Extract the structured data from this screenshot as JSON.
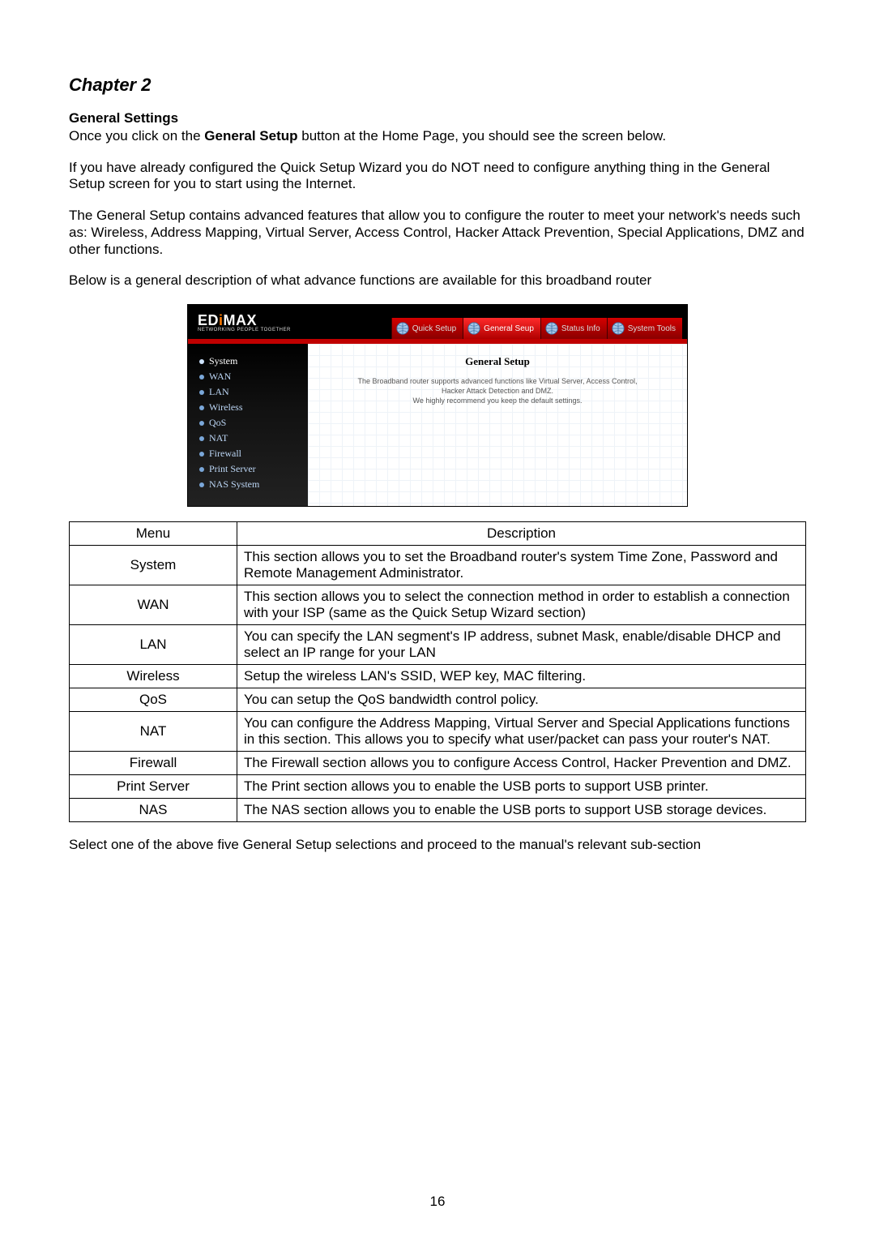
{
  "chapter_title": "Chapter 2",
  "section_title": "General Settings",
  "para1_a": "Once you click on the ",
  "para1_bold": "General Setup",
  "para1_b": " button at the Home Page, you should see the screen below.",
  "para2": "If you have already configured the Quick Setup Wizard you do NOT need to configure anything thing in the General Setup screen for you to start using the Internet.",
  "para3": "The General Setup contains advanced features that allow you to configure the router to meet your network's needs such as: Wireless, Address Mapping, Virtual Server, Access Control, Hacker Attack Prevention, Special Applications, DMZ and other functions.",
  "para4": "Below is a general description of what advance functions are available for this broadband router",
  "para5": "Select one of the above five General Setup selections and proceed to the manual's relevant sub-section",
  "page_number": "16",
  "screenshot": {
    "logo_main_a": "ED",
    "logo_main_b": "i",
    "logo_main_c": "MAX",
    "logo_sub": "NETWORKING PEOPLE TOGETHER",
    "tabs": [
      "Quick Setup",
      "General Seup",
      "Status Info",
      "System Tools"
    ],
    "sidebar": [
      "System",
      "WAN",
      "LAN",
      "Wireless",
      "QoS",
      "NAT",
      "Firewall",
      "Print Server",
      "NAS System"
    ],
    "content_title": "General Setup",
    "content_line1": "The Broadband router supports advanced functions like Virtual Server, Access Control,",
    "content_line2": "Hacker Attack Detection and DMZ.",
    "content_line3": "We highly recommend you keep the default settings."
  },
  "table": {
    "head_menu": "Menu",
    "head_desc": "Description",
    "rows": [
      {
        "menu": "System",
        "desc": "This section allows you to set the Broadband router's system Time Zone, Password and Remote Management Administrator."
      },
      {
        "menu": "WAN",
        "desc": "This section allows you to select the connection method in order to establish a connection with your ISP (same as the Quick Setup Wizard section)"
      },
      {
        "menu": "LAN",
        "desc": "You can specify the LAN segment's IP address, subnet Mask, enable/disable DHCP and select an IP range for your LAN"
      },
      {
        "menu": "Wireless",
        "desc": "Setup the wireless LAN's SSID, WEP key, MAC filtering."
      },
      {
        "menu": "QoS",
        "desc": "You can setup the QoS bandwidth control policy."
      },
      {
        "menu": "NAT",
        "desc": "You can configure the Address Mapping, Virtual Server and Special Applications functions in this section. This allows you to specify what user/packet can pass your router's NAT."
      },
      {
        "menu": "Firewall",
        "desc": "The Firewall section allows you to configure Access Control, Hacker Prevention and DMZ."
      },
      {
        "menu": "Print Server",
        "desc": "The Print section allows you to enable the USB ports to support USB printer."
      },
      {
        "menu": "NAS",
        "desc": "The NAS section allows you to enable the USB ports to support USB storage devices."
      }
    ]
  }
}
